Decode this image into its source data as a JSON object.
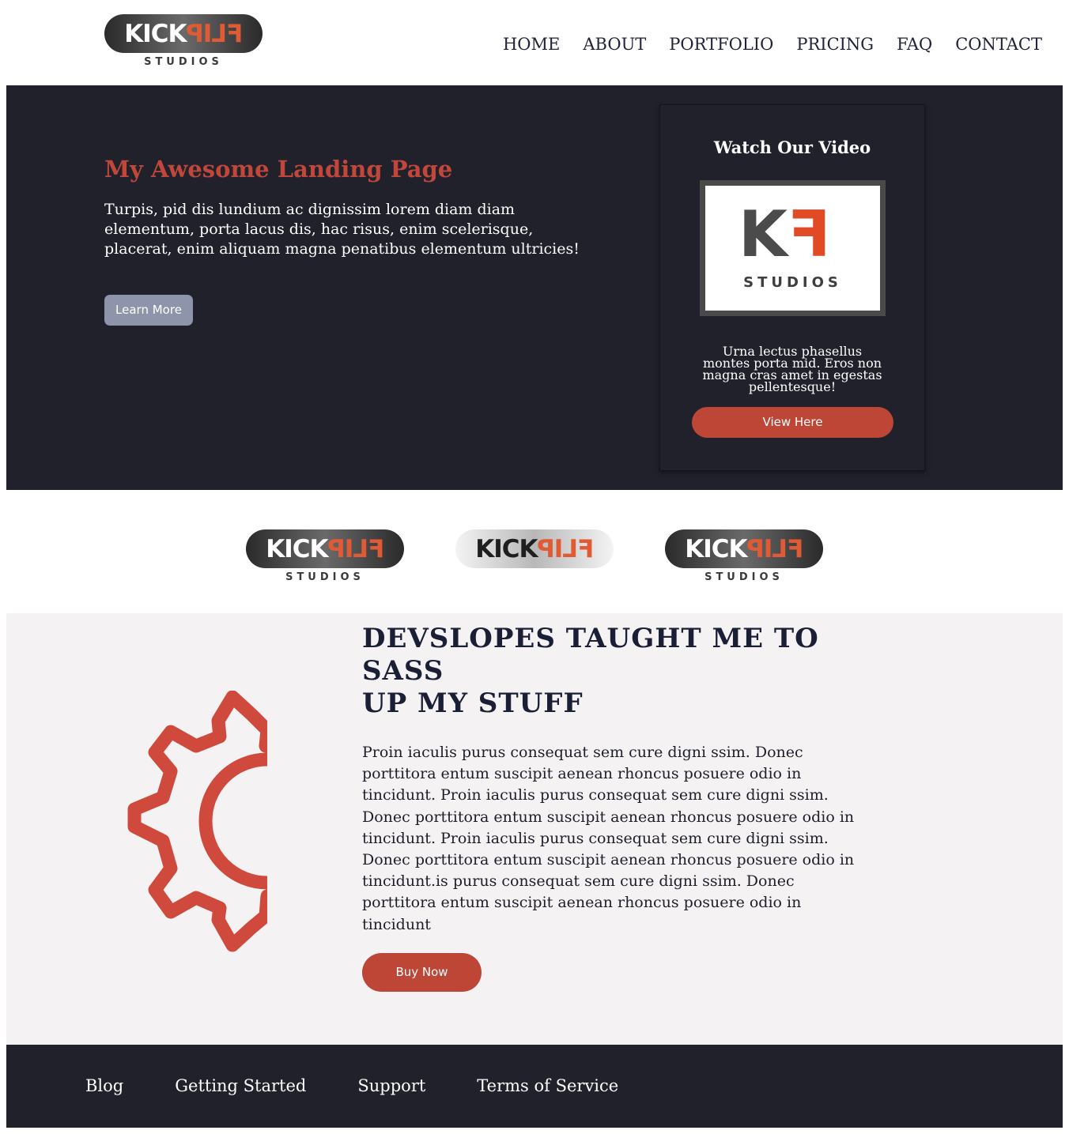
{
  "header": {
    "logo": {
      "word_left": "KICK",
      "word_right": "FLIP",
      "sub": "STUDIOS"
    },
    "nav": [
      "HOME",
      "ABOUT",
      "PORTFOLIO",
      "PRICING",
      "FAQ",
      "CONTACT"
    ]
  },
  "hero": {
    "title": "My Awesome Landing Page",
    "text": "Turpis, pid dis lundium ac dignissim lorem diam diam elementum, porta lacus dis, hac risus, enim scelerisque, placerat, enim aliquam magna penatibus elementum ultricies!",
    "button": "Learn More",
    "video_card": {
      "title": "Watch Our Video",
      "logo": {
        "letter_left": "K",
        "letter_right": "F",
        "sub": "STUDIOS"
      },
      "text": "Urna lectus phasellus montes porta mid. Eros non magna cras amet in egestas pellentesque!",
      "button": "View Here"
    }
  },
  "logos_strip": [
    {
      "word_left": "KICK",
      "word_right": "FLIP",
      "sub": "STUDIOS"
    },
    {
      "word_left": "KICK",
      "word_right": "FLIP",
      "sub": ""
    },
    {
      "word_left": "KICK",
      "word_right": "FLIP",
      "sub": "STUDIOS"
    }
  ],
  "feature": {
    "title_line1": "DEVSLOPES TAUGHT ME TO",
    "title_line2": "SASS",
    "title_line3": "UP MY STUFF",
    "text": "Proin iaculis purus consequat sem cure digni ssim. Donec porttitora entum suscipit aenean rhoncus posuere odio in tincidunt. Proin iaculis purus consequat sem cure digni ssim. Donec porttitora entum suscipit aenean rhoncus posuere odio in tincidunt. Proin iaculis purus consequat sem cure digni ssim. Donec porttitora entum suscipit aenean rhoncus posuere odio in tincidunt.is purus consequat sem cure digni ssim. Donec porttitora entum suscipit aenean rhoncus posuere odio in tincidunt",
    "button": "Buy Now",
    "icon": "gear-icon"
  },
  "footer": {
    "links": [
      "Blog",
      "Getting Started",
      "Support",
      "Terms of Service"
    ]
  },
  "colors": {
    "accent": "#be4637",
    "dark_bg": "#21212c",
    "light_bg": "#f4f2f3",
    "muted_button": "#8e94aa",
    "title_red": "#c0473a"
  }
}
